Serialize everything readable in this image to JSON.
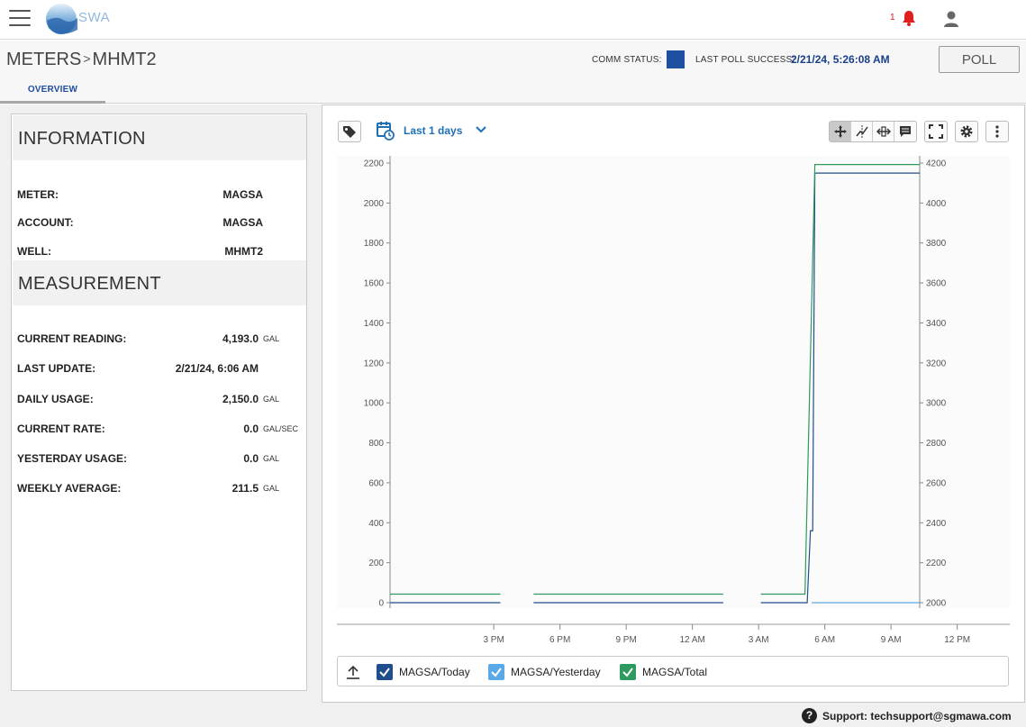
{
  "app": {
    "logo_text": "SWA",
    "notification_count": "1"
  },
  "header": {
    "breadcrumb_root": "METERS",
    "breadcrumb_sep": ">",
    "breadcrumb_current": "MHMT2",
    "comm_status_label": "COMM STATUS:",
    "comm_status_color": "#1f4fa0",
    "last_poll_label": "LAST POLL SUCCESS:",
    "last_poll_value": "2/21/24, 5:26:08 AM",
    "poll_button": "POLL"
  },
  "tabs": [
    {
      "label": "OVERVIEW",
      "active": true
    }
  ],
  "information": {
    "title": "INFORMATION",
    "rows": [
      {
        "label": "METER:",
        "value": "MAGSA"
      },
      {
        "label": "ACCOUNT:",
        "value": "MAGSA"
      },
      {
        "label": "WELL:",
        "value": "MHMT2"
      }
    ]
  },
  "measurement": {
    "title": "MEASUREMENT",
    "rows": [
      {
        "label": "CURRENT READING:",
        "value": "4,193.0",
        "unit": "GAL"
      },
      {
        "label": "LAST UPDATE:",
        "value": "2/21/24, 6:06 AM",
        "unit": ""
      },
      {
        "label": "DAILY USAGE:",
        "value": "2,150.0",
        "unit": "GAL"
      },
      {
        "label": "CURRENT RATE:",
        "value": "0.0",
        "unit": "GAL/SEC"
      },
      {
        "label": "YESTERDAY USAGE:",
        "value": "0.0",
        "unit": "GAL"
      },
      {
        "label": "WEEKLY AVERAGE:",
        "value": "211.5",
        "unit": "GAL"
      }
    ]
  },
  "toolbar": {
    "range_label": "Last 1 days",
    "icons": [
      "tag-icon",
      "calendar-clock-icon",
      "chevron-down-icon",
      "pan-icon",
      "crosshair-icon",
      "resize-icon",
      "comment-icon",
      "fullscreen-icon",
      "gear-icon",
      "more-vert-icon"
    ]
  },
  "chart_data": {
    "type": "line",
    "x_ticks": [
      "3 PM",
      "6 PM",
      "9 PM",
      "12 AM",
      "3 AM",
      "6 AM",
      "9 AM",
      "12 PM"
    ],
    "x_start_hour": 10.3,
    "x_end_hour": 34.3,
    "y_left": {
      "ticks": [
        0,
        200,
        400,
        600,
        800,
        1000,
        1200,
        1400,
        1600,
        1800,
        2000,
        2200
      ],
      "ylim": [
        0,
        2200
      ]
    },
    "y_right": {
      "ticks": [
        2000,
        2200,
        2400,
        2600,
        2800,
        3000,
        3200,
        3400,
        3600,
        3800,
        4000,
        4200
      ],
      "ylim": [
        2000,
        4200
      ]
    },
    "series": [
      {
        "name": "MAGSA/Today",
        "color": "#1f4e8c",
        "axis": "left",
        "segments": [
          [
            [
              10.3,
              0
            ],
            [
              15.3,
              0
            ]
          ],
          [
            [
              16.8,
              0
            ],
            [
              25.4,
              0
            ]
          ],
          [
            [
              27.1,
              0
            ],
            [
              29.2,
              0
            ],
            [
              29.35,
              360
            ],
            [
              29.45,
              360
            ],
            [
              29.55,
              2150
            ],
            [
              34.3,
              2150
            ]
          ]
        ]
      },
      {
        "name": "MAGSA/Yesterday",
        "color": "#5aa9e6",
        "axis": "left",
        "segments": [
          [
            [
              29.4,
              0
            ],
            [
              34.3,
              0
            ]
          ]
        ]
      },
      {
        "name": "MAGSA/Total",
        "color": "#2e9a5e",
        "axis": "right",
        "segments": [
          [
            [
              10.3,
              2043
            ],
            [
              15.3,
              2043
            ]
          ],
          [
            [
              16.8,
              2043
            ],
            [
              25.4,
              2043
            ]
          ],
          [
            [
              27.1,
              2043
            ],
            [
              29.1,
              2043
            ],
            [
              29.55,
              4193
            ],
            [
              34.3,
              4193
            ]
          ]
        ]
      }
    ]
  },
  "legend": [
    {
      "label": "MAGSA/Today",
      "color": "#1f4e8c",
      "checked": true
    },
    {
      "label": "MAGSA/Yesterday",
      "color": "#5aa9e6",
      "checked": true
    },
    {
      "label": "MAGSA/Total",
      "color": "#2e9a5e",
      "checked": true
    }
  ],
  "footer": {
    "support": "Support: techsupport@sgmawa.com"
  }
}
